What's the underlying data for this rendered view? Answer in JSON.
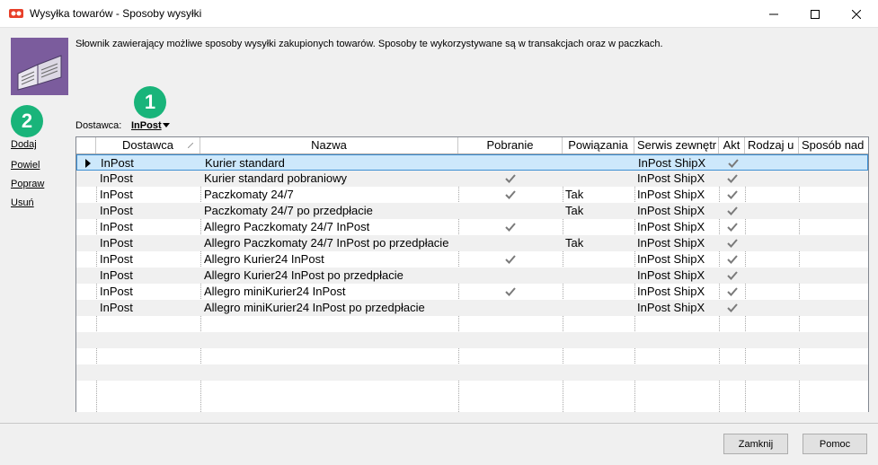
{
  "window": {
    "title": "Wysyłka towarów - Sposoby wysyłki",
    "icon": "app-logo-icon"
  },
  "description": "Słownik zawierający możliwe sposoby wysyłki zakupionych towarów. Sposoby te wykorzystywane są w transakcjach oraz w paczkach.",
  "sidebar": {
    "items": [
      {
        "label": "Dodaj"
      },
      {
        "label": "Powiel"
      },
      {
        "label": "Popraw"
      },
      {
        "label": "Usuń"
      }
    ]
  },
  "badges": [
    "1",
    "2"
  ],
  "filter": {
    "label": "Dostawca:",
    "value": "InPost"
  },
  "table": {
    "columns": [
      "Dostawca",
      "Nazwa",
      "Pobranie",
      "Powiązania",
      "Serwis zewnętr",
      "Akt",
      "Rodzaj u",
      "Sposób nad"
    ],
    "rows": [
      {
        "dostawca": "InPost",
        "nazwa": "Kurier standard",
        "pobranie": false,
        "powiazania": "",
        "serwis": "InPost ShipX",
        "akt": true
      },
      {
        "dostawca": "InPost",
        "nazwa": "Kurier standard pobraniowy",
        "pobranie": true,
        "powiazania": "",
        "serwis": "InPost ShipX",
        "akt": true
      },
      {
        "dostawca": "InPost",
        "nazwa": "Paczkomaty 24/7",
        "pobranie": true,
        "powiazania": "Tak",
        "serwis": "InPost ShipX",
        "akt": true
      },
      {
        "dostawca": "InPost",
        "nazwa": "Paczkomaty 24/7 po przedpłacie",
        "pobranie": false,
        "powiazania": "Tak",
        "serwis": "InPost ShipX",
        "akt": true
      },
      {
        "dostawca": "InPost",
        "nazwa": "Allegro Paczkomaty 24/7 InPost",
        "pobranie": true,
        "powiazania": "",
        "serwis": "InPost ShipX",
        "akt": true
      },
      {
        "dostawca": "InPost",
        "nazwa": "Allegro Paczkomaty 24/7 InPost po przedpłacie",
        "pobranie": false,
        "powiazania": "Tak",
        "serwis": "InPost ShipX",
        "akt": true
      },
      {
        "dostawca": "InPost",
        "nazwa": "Allegro Kurier24 InPost",
        "pobranie": true,
        "powiazania": "",
        "serwis": "InPost ShipX",
        "akt": true
      },
      {
        "dostawca": "InPost",
        "nazwa": "Allegro Kurier24 InPost po przedpłacie",
        "pobranie": false,
        "powiazania": "",
        "serwis": "InPost ShipX",
        "akt": true
      },
      {
        "dostawca": "InPost",
        "nazwa": "Allegro miniKurier24 InPost",
        "pobranie": true,
        "powiazania": "",
        "serwis": "InPost ShipX",
        "akt": true
      },
      {
        "dostawca": "InPost",
        "nazwa": "Allegro miniKurier24 InPost po przedpłacie",
        "pobranie": false,
        "powiazania": "",
        "serwis": "InPost ShipX",
        "akt": true
      }
    ]
  },
  "buttons": {
    "close": "Zamknij",
    "help": "Pomoc"
  },
  "colors": {
    "badge": "#19b47a",
    "selected_row": "#cde8fb",
    "selected_border": "#3c8fd4"
  }
}
